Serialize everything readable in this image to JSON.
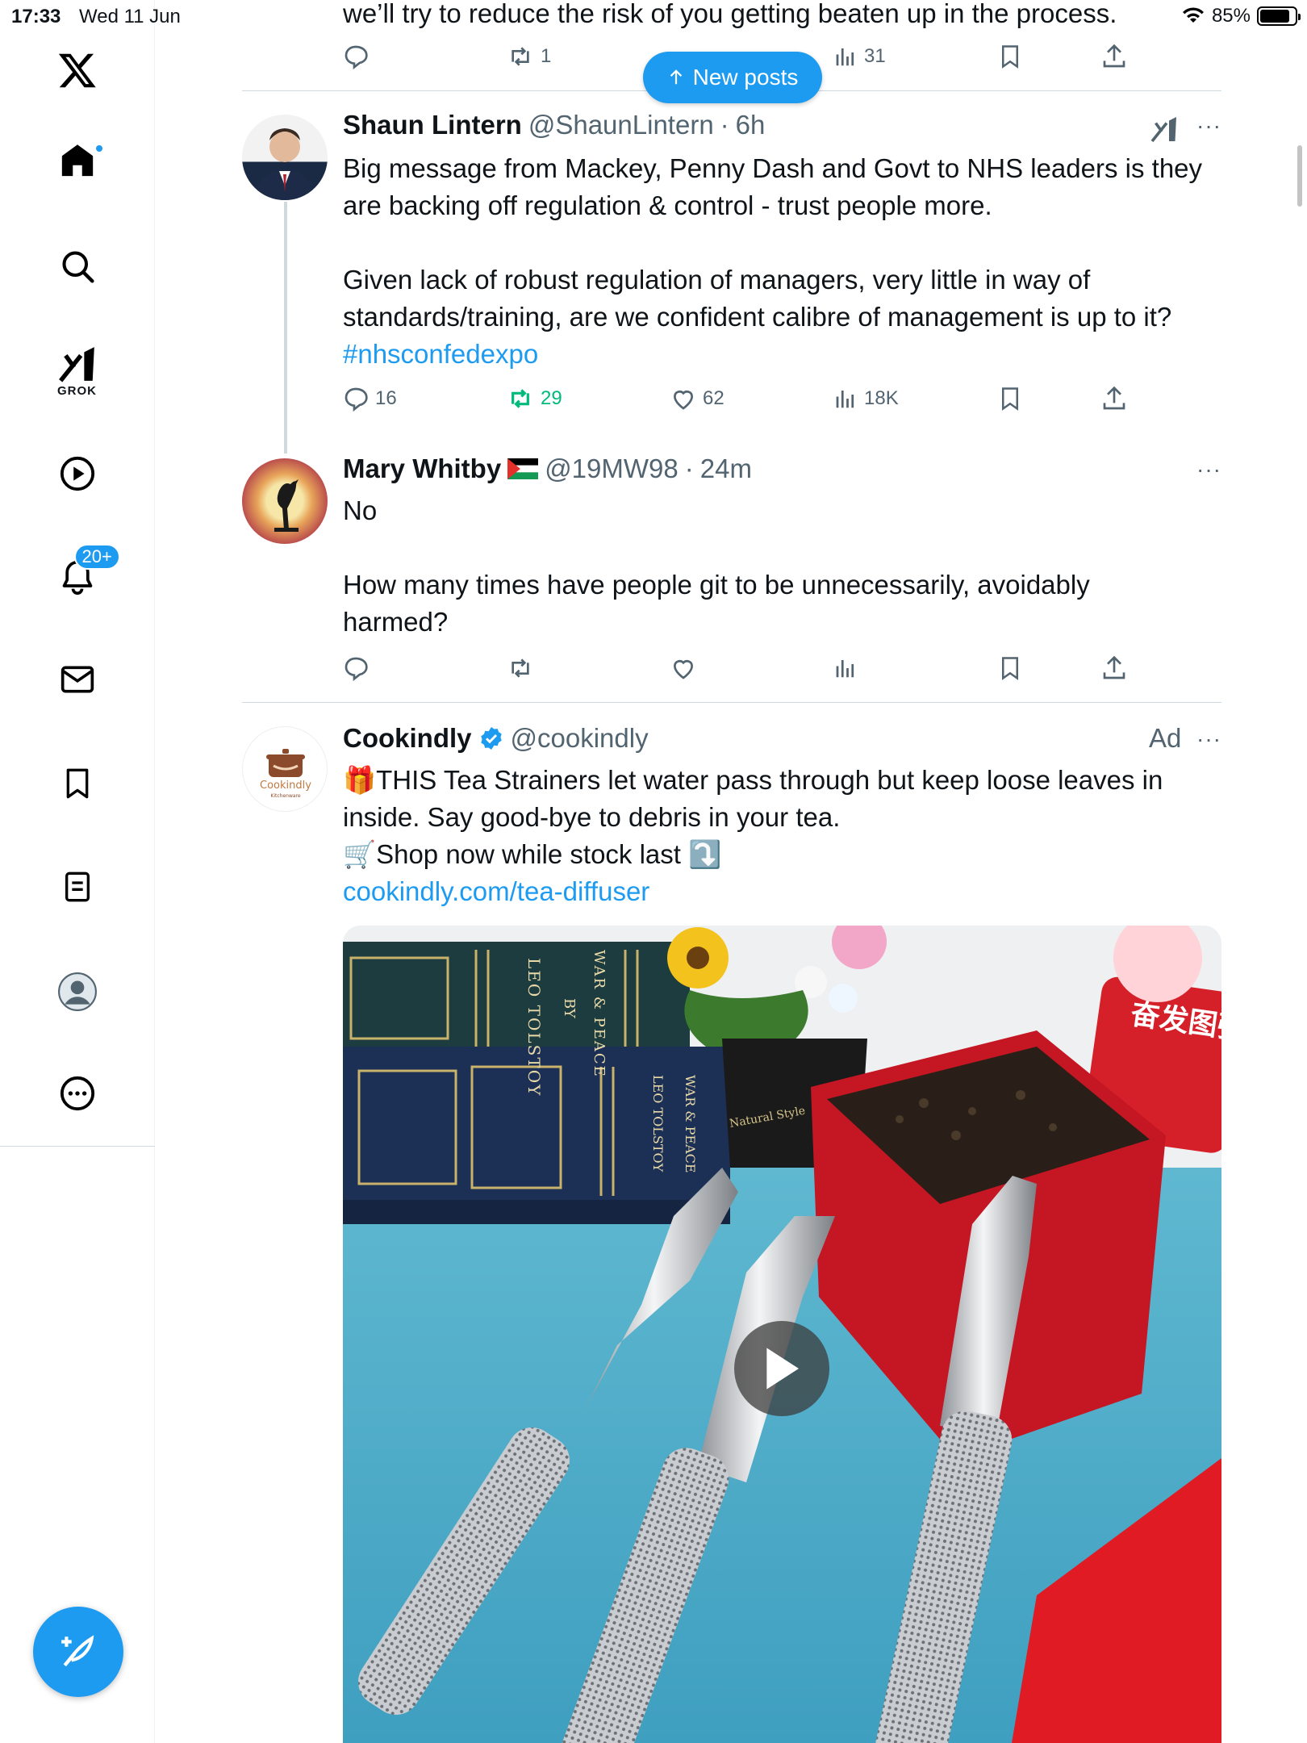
{
  "status_bar": {
    "time": "17:33",
    "date": "Wed 11 Jun",
    "battery": "85%",
    "battery_level": 0.85
  },
  "sidebar": {
    "items": [
      {
        "icon": "x-logo-icon"
      },
      {
        "icon": "home-icon",
        "has_dot": true
      },
      {
        "icon": "search-icon"
      },
      {
        "icon": "grok-icon",
        "label": "GROK"
      },
      {
        "icon": "video-play-icon"
      },
      {
        "icon": "bell-icon",
        "badge": "20+"
      },
      {
        "icon": "mail-icon"
      },
      {
        "icon": "bookmark-icon"
      },
      {
        "icon": "lists-icon"
      },
      {
        "icon": "profile-icon"
      },
      {
        "icon": "more-circle-icon"
      }
    ],
    "compose_icon": "compose-feather-icon"
  },
  "new_posts": {
    "label": "New posts"
  },
  "top_tweet": {
    "text": "we’ll try to reduce the risk of you getting beaten up in the process.",
    "actions": {
      "replies": "",
      "reposts": "1",
      "views": "31"
    }
  },
  "tweets": [
    {
      "name": "Shaun Lintern",
      "handle": "@ShaunLintern",
      "time": "6h",
      "lines": [
        "Big message from Mackey, Penny Dash and Govt to NHS leaders is they",
        "are backing off regulation & control - trust people more.",
        "",
        "Given lack of robust regulation of managers, very little in way of",
        "standards/training, are we confident calibre of management is up to it?"
      ],
      "hashtag": "#nhsconfedexpo",
      "actions": {
        "replies": "16",
        "reposts": "29",
        "likes": "62",
        "views": "18K"
      }
    },
    {
      "name": "Mary Whitby",
      "handle": "@19MW98",
      "time": "24m",
      "lines": [
        "No",
        "",
        "How many times have people git to be unnecessarily,  avoidably",
        "harmed?"
      ],
      "actions": {
        "replies": "",
        "reposts": "",
        "likes": "",
        "views": ""
      }
    },
    {
      "name": "Cookindly",
      "handle": "@cookindly",
      "ad_label": "Ad",
      "avatar_text": "Cookindly",
      "avatar_subtext": "Kitchenware",
      "lines": [
        "🎁THIS Tea Strainers let water pass through but keep loose leaves in",
        "inside. Say good-bye to debris in your tea.",
        "🛒Shop now while stock last ⤵️"
      ],
      "link": "cookindly.com/tea-diffuser"
    }
  ],
  "media": {
    "book_spine_1": "LEO TOLSTOY",
    "book_spine_2": "WAR & PEACE",
    "book_by": "BY",
    "sign_text": "奋发图强",
    "tin_label": "Natural Style"
  },
  "colors": {
    "accent": "#1d9bf0",
    "repost": "#00ba7c",
    "muted": "#536471"
  }
}
